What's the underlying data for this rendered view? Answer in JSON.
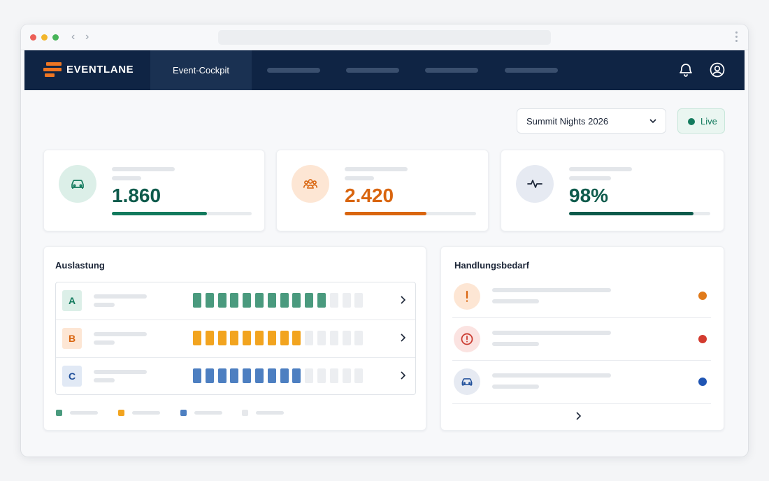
{
  "app": {
    "brand": "EVENTLANE",
    "active_tab": "Event-Cockpit"
  },
  "event_select": {
    "value": "Summit Nights 2026"
  },
  "live_status": {
    "label": "Live",
    "color": "#127a5d"
  },
  "kpis": [
    {
      "value": "1.860",
      "icon": "car-icon",
      "color": "#127a5d",
      "progress": 0.68
    },
    {
      "value": "2.420",
      "icon": "people-icon",
      "color": "#d9650f",
      "progress": 0.62
    },
    {
      "value": "98%",
      "icon": "pulse-icon",
      "color": "#0d5a4b",
      "progress": 0.88
    }
  ],
  "occupancy": {
    "title": "Auslastung",
    "zones": [
      {
        "label": "A",
        "filled": 11,
        "total": 14,
        "color": "#4a9a7e"
      },
      {
        "label": "B",
        "filled": 9,
        "total": 14,
        "color": "#f2a41f"
      },
      {
        "label": "C",
        "filled": 9,
        "total": 14,
        "color": "#4d7fc1"
      }
    ],
    "legend_colors": [
      "#4a9a7e",
      "#f2a41f",
      "#4d7fc1",
      "#e6e8eb"
    ]
  },
  "actions": {
    "title": "Handlungsbedarf",
    "items": [
      {
        "icon": "exclamation-icon",
        "status_color": "#e07a1a"
      },
      {
        "icon": "alert-circle-icon",
        "status_color": "#d33b2f"
      },
      {
        "icon": "car-icon",
        "status_color": "#1f55b3"
      }
    ]
  }
}
